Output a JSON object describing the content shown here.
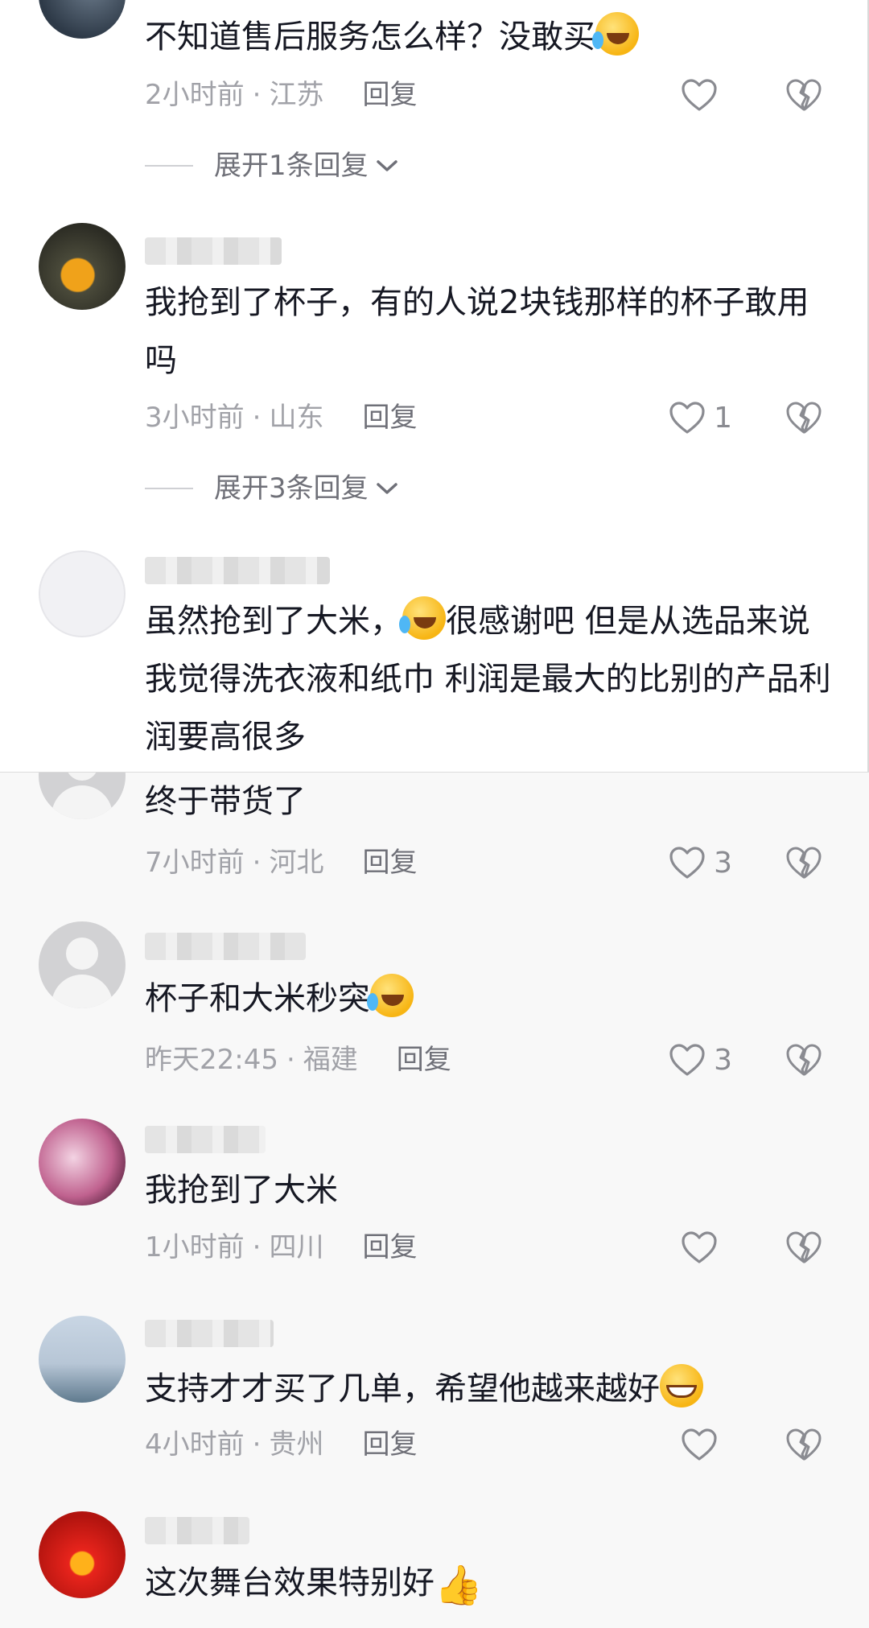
{
  "comments": [
    {
      "text": "不知道售后服务怎么样？没敢买",
      "emoji": "cry-laugh-emoji",
      "time": "2小时前",
      "location": "江苏",
      "reply_label": "回复",
      "like_count": "",
      "expand_label": "展开1条回复"
    },
    {
      "text": "我抢到了杯子，有的人说2块钱那样的杯子敢用吗",
      "time": "3小时前",
      "location": "山东",
      "reply_label": "回复",
      "like_count": "1",
      "expand_label": "展开3条回复"
    },
    {
      "text_a": "虽然抢到了大米，",
      "emoji": "cry-laugh-emoji",
      "text_b": "很感谢吧 但是从选品来说我觉得洗衣液和纸巾 利润是最大的比别的产品利润要高很多"
    },
    {
      "text": "终于带货了",
      "time": "7小时前",
      "location": "河北",
      "reply_label": "回复",
      "like_count": "3"
    },
    {
      "text": "杯子和大米秒突",
      "emoji": "cry-laugh-emoji",
      "time": "昨天22:45",
      "location": "福建",
      "reply_label": "回复",
      "like_count": "3"
    },
    {
      "text": "我抢到了大米",
      "time": "1小时前",
      "location": "四川",
      "reply_label": "回复",
      "like_count": ""
    },
    {
      "text": "支持才才买了几单，希望他越来越好",
      "emoji": "grin-emoji",
      "time": "4小时前",
      "location": "贵州",
      "reply_label": "回复",
      "like_count": ""
    },
    {
      "text": "这次舞台效果特别好",
      "emoji": "thumbs-up-emoji"
    }
  ],
  "separator": "·",
  "colors": {
    "text": "#161823",
    "meta": "#a1a2a8",
    "reply": "#6f7078",
    "icon": "#8a8b91"
  }
}
